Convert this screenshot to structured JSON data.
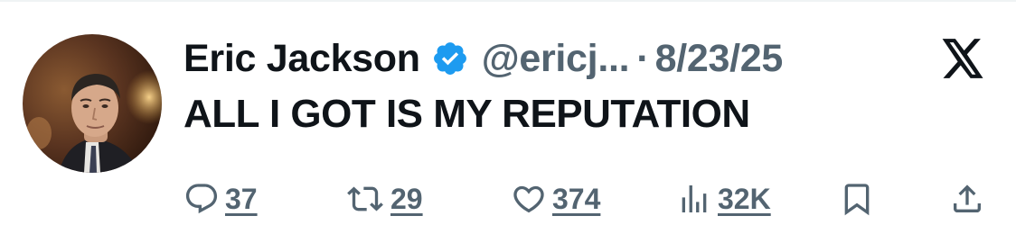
{
  "author": {
    "name": "Eric Jackson",
    "handle": "@ericj...",
    "separator": "·",
    "date": "8/23/25",
    "verified": true,
    "avatar_icon": "profile-photo",
    "badge_icon": "verified-badge-icon",
    "brand_icon": "x-logo-icon"
  },
  "tweet": {
    "text": "ALL I GOT IS MY REPUTATION"
  },
  "actions": {
    "replies": {
      "icon": "reply-icon",
      "count": "37"
    },
    "reposts": {
      "icon": "repost-icon",
      "count": "29"
    },
    "likes": {
      "icon": "like-icon",
      "count": "374"
    },
    "views": {
      "icon": "views-icon",
      "count": "32K"
    },
    "bookmark": {
      "icon": "bookmark-icon"
    },
    "share": {
      "icon": "share-icon"
    }
  },
  "colors": {
    "text_primary": "#0f1419",
    "text_secondary": "#536471",
    "verified_blue": "#1d9bf0"
  }
}
